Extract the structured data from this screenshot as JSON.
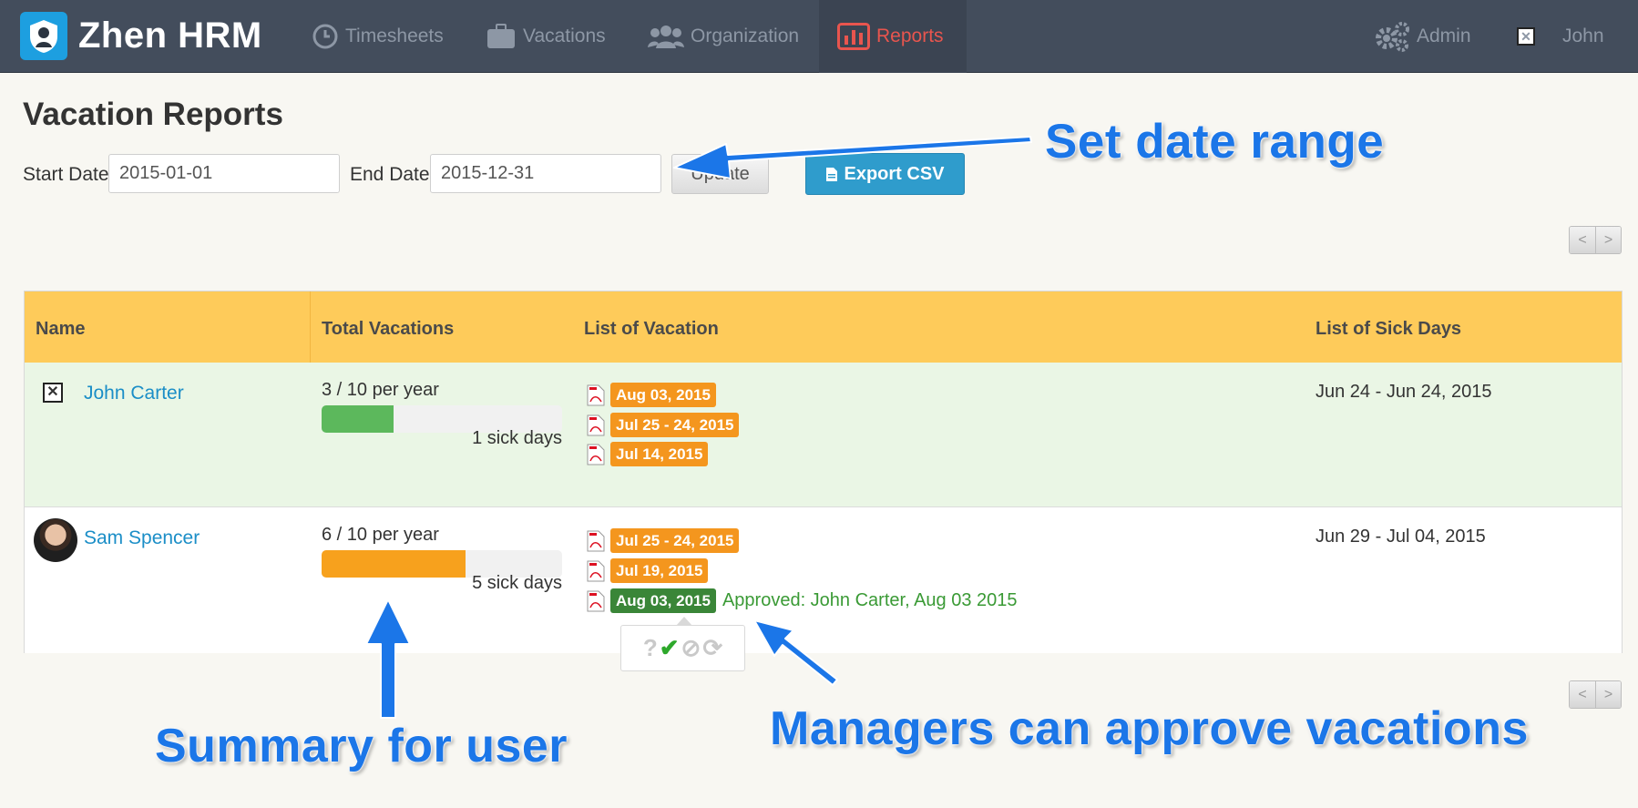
{
  "app": {
    "brand": "Zhen HRM",
    "user": "John"
  },
  "nav": {
    "timesheets": "Timesheets",
    "vacations": "Vacations",
    "organization": "Organization",
    "reports": "Reports",
    "admin": "Admin"
  },
  "page": {
    "title": "Vacation Reports"
  },
  "form": {
    "start_label": "Start Date",
    "start_value": "2015-01-01",
    "end_label": "End Date",
    "end_value": "2015-12-31",
    "update_label": "Update",
    "export_label": "Export CSV"
  },
  "pager": {
    "prev": "<",
    "next": ">"
  },
  "table": {
    "headers": [
      "Name",
      "Total Vacations",
      "List of Vacation",
      "List of Sick Days"
    ],
    "rows": [
      {
        "name": "John Carter",
        "total": "3 / 10 per year",
        "progress": 0.3,
        "progress_color": "#5cb85c",
        "sick_days": "1 sick days",
        "vacations": [
          "Aug 03, 2015",
          "Jul 25 - 24, 2015",
          "Jul 14, 2015"
        ],
        "sick_range": "Jun 24 - Jun 24, 2015"
      },
      {
        "name": "Sam Spencer",
        "total": "6 / 10 per year",
        "progress": 0.6,
        "progress_color": "#f7a11d",
        "sick_days": "5 sick days",
        "vacations": [
          "Jul 25 - 24, 2015",
          "Jul 19, 2015",
          "Aug 03, 2015"
        ],
        "approved_note": "Approved: John Carter, Aug 03 2015",
        "sick_range": "Jun 29 - Jul 04, 2015"
      }
    ]
  },
  "approval_popup": {
    "pending": "?",
    "approve": "✔",
    "reject": "⊘",
    "reset": "⟳"
  },
  "annotations": {
    "date_range": "Set date range",
    "summary": "Summary for user",
    "approve": "Managers can approve vacations"
  },
  "colors": {
    "nav_bg": "#434d5c",
    "active_nav": "#e8554e",
    "table_header": "#fecb5a",
    "badge": "#f4961e",
    "approved_badge": "#3a8638",
    "annotation": "#1b76e8"
  }
}
